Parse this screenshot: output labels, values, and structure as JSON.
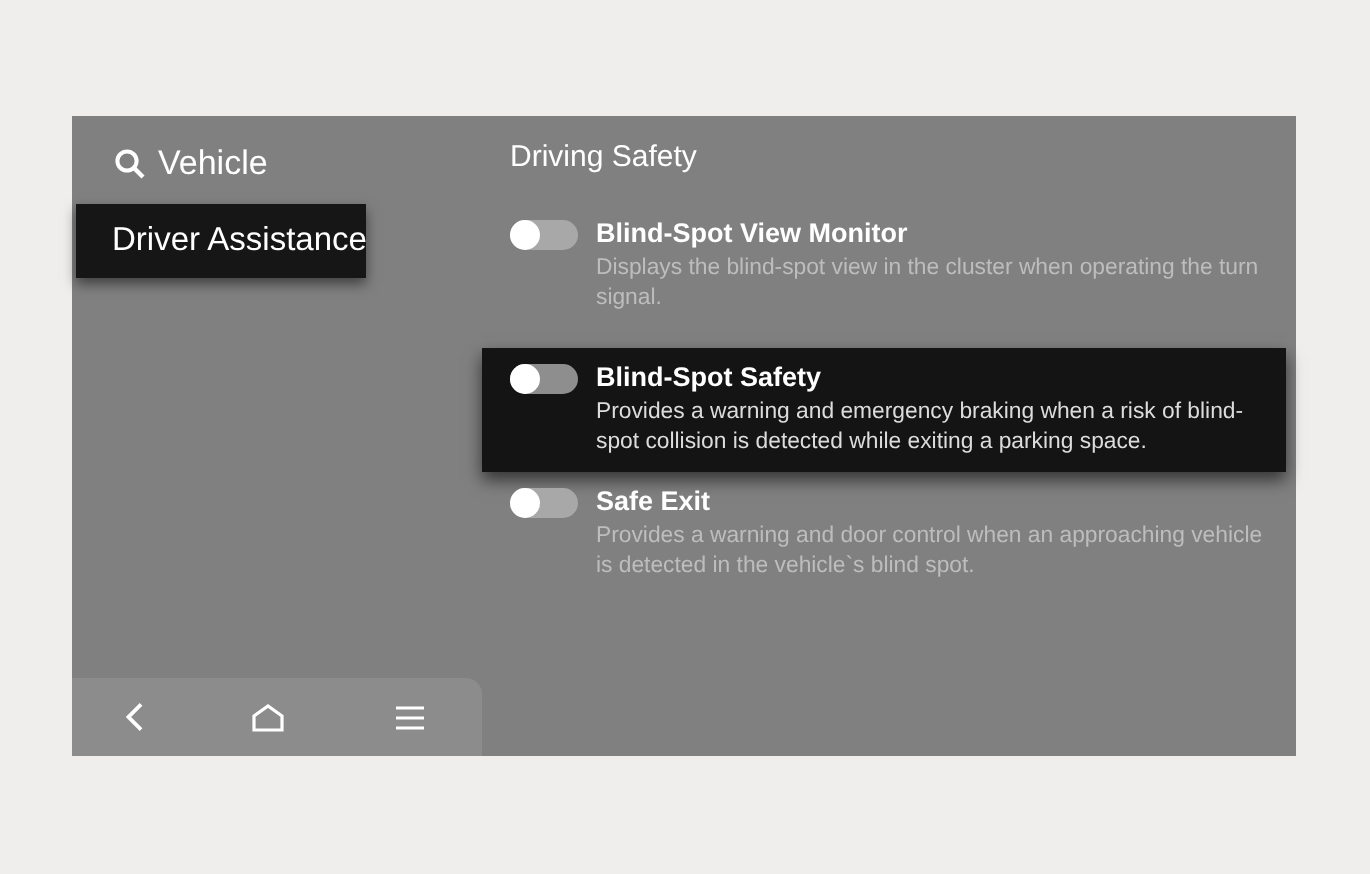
{
  "sidebar": {
    "header": "Vehicle",
    "items": [
      {
        "label": "Driver Assistance",
        "selected": true
      }
    ]
  },
  "nav_bar": {
    "buttons": [
      {
        "kind": "back"
      },
      {
        "kind": "home"
      },
      {
        "kind": "menu"
      }
    ]
  },
  "content": {
    "title": "Driving Safety",
    "items": [
      {
        "title": "Blind-Spot View Monitor",
        "description": "Displays the blind-spot view in the cluster when operating the turn signal.",
        "on": false,
        "selected": false
      },
      {
        "title": "Blind-Spot Safety",
        "description": "Provides a warning and emergency braking when a risk of blind-spot collision is detected while exiting a parking space.",
        "on": false,
        "selected": true
      },
      {
        "title": "Safe Exit",
        "description": "Provides a warning and door control when an approaching vehicle is detected in the vehicle`s blind spot.",
        "on": false,
        "selected": false
      }
    ]
  }
}
